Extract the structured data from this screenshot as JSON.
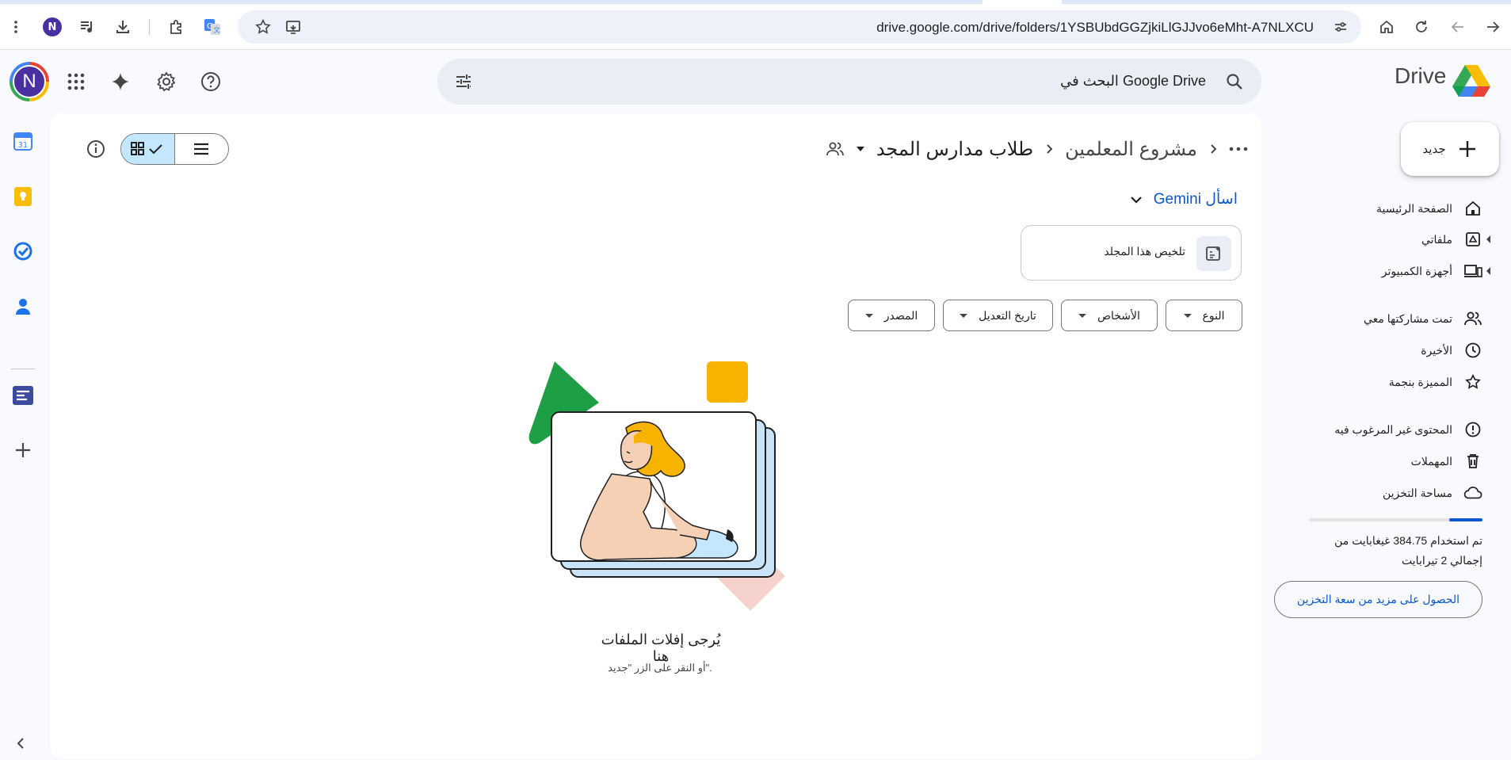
{
  "browser": {
    "url": "drive.google.com/drive/folders/1YSBUbdGGZjkiLlGJJvo6eMht-A7NLXCU",
    "profile_initial": "N"
  },
  "header": {
    "avatar_initial": "N",
    "search_placeholder": "البحث في Google Drive",
    "brand": "Drive"
  },
  "breadcrumb": {
    "parent": "مشروع المعلمين",
    "current": "طلاب مدارس المجد"
  },
  "gemini": {
    "ask_label": "اسأل Gemini",
    "summary_label": "تلخيص هذا المجلد"
  },
  "filters": {
    "type": "النوع",
    "people": "الأشخاص",
    "modified": "تاريخ التعديل",
    "source": "المصدر"
  },
  "empty_state": {
    "title": "يُرجى إفلات الملفات هنا",
    "subtitle": "أو النقر على الزر \"جديد\"."
  },
  "sidebar": {
    "new_label": "جديد",
    "items": [
      {
        "label": "الصفحة الرئيسية",
        "icon": "home-icon"
      },
      {
        "label": "ملفاتي",
        "icon": "my-drive-icon"
      },
      {
        "label": "أجهزة الكمبيوتر",
        "icon": "computers-icon"
      },
      {
        "label": "تمت مشاركتها معي",
        "icon": "shared-icon"
      },
      {
        "label": "الأخيرة",
        "icon": "clock-icon"
      },
      {
        "label": "المميزة بنجمة",
        "icon": "star-icon"
      },
      {
        "label": "المحتوى غير المرغوب فيه",
        "icon": "spam-icon"
      },
      {
        "label": "المهملات",
        "icon": "trash-icon"
      },
      {
        "label": "مساحة التخزين",
        "icon": "cloud-icon"
      }
    ]
  },
  "storage": {
    "line1": "تم استخدام 384.75 غيغابايت من",
    "line2": "إجمالي 2 تيرابايت",
    "used_fraction": 0.19,
    "button": "الحصول على مزيد من سعة التخزين"
  },
  "colors": {
    "accent": "#0b57d0",
    "selected_toggle": "#c2e7ff",
    "avatar_bg": "#4a2fa0"
  }
}
